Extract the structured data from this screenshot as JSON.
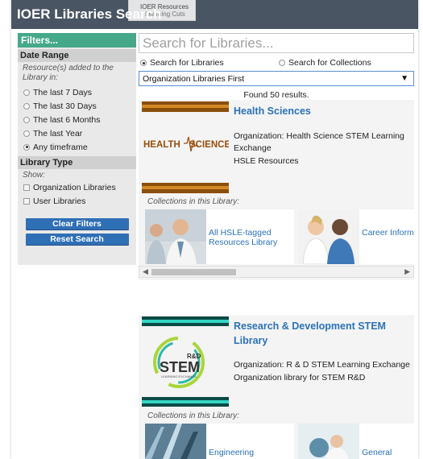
{
  "header": {
    "title": "IOER Libraries Search",
    "logo_line1": "IOER Resources",
    "logo_line2": "Learning Cuts"
  },
  "sidebar": {
    "heading": "Filters...",
    "date_range": {
      "title": "Date Range",
      "note": "Resource(s) added to the Library in:",
      "options": [
        {
          "label": "The last 7 Days",
          "selected": false
        },
        {
          "label": "The last 30 Days",
          "selected": false
        },
        {
          "label": "The last 6 Months",
          "selected": false
        },
        {
          "label": "The last Year",
          "selected": false
        },
        {
          "label": "Any timeframe",
          "selected": true
        }
      ]
    },
    "library_type": {
      "title": "Library Type",
      "note": "Show:",
      "options": [
        {
          "label": "Organization Libraries",
          "checked": false
        },
        {
          "label": "User Libraries",
          "checked": false
        }
      ]
    },
    "clear_label": "Clear Filters",
    "reset_label": "Reset Search"
  },
  "search": {
    "placeholder": "Search for Libraries...",
    "mode_libraries": "Search for Libraries",
    "mode_collections": "Search for Collections",
    "selected_mode": "libraries",
    "sort_value": "Organization Libraries First",
    "results": "Found 50 results."
  },
  "results": [
    {
      "name": "Health Sciences",
      "logo_text_left": "HEALTH",
      "logo_text_right": "SCIENCE",
      "organization": "Organization: Health Science STEM Learning Exchange",
      "description": "HSLE Resources",
      "collections_label": "Collections in this Library:",
      "collections": [
        {
          "label": "All HSLE-tagged Resources Library"
        },
        {
          "label": "Career Inform"
        }
      ]
    },
    {
      "name": "Research & Development STEM Library",
      "logo_small": "R&D",
      "logo_main": "STEM",
      "logo_sub": "LEARNING EXCHANGE",
      "organization": "Organization: R & D STEM Learning Exchange",
      "description": "Organization library for STEM R&D",
      "collections_label": "Collections in this Library:",
      "collections": [
        {
          "label": "Engineering"
        },
        {
          "label": "General"
        }
      ]
    }
  ],
  "colors": {
    "titlebar": "#4a5563",
    "filters_head": "#45a889",
    "button": "#2f6fb6",
    "link": "#2b72b7"
  }
}
